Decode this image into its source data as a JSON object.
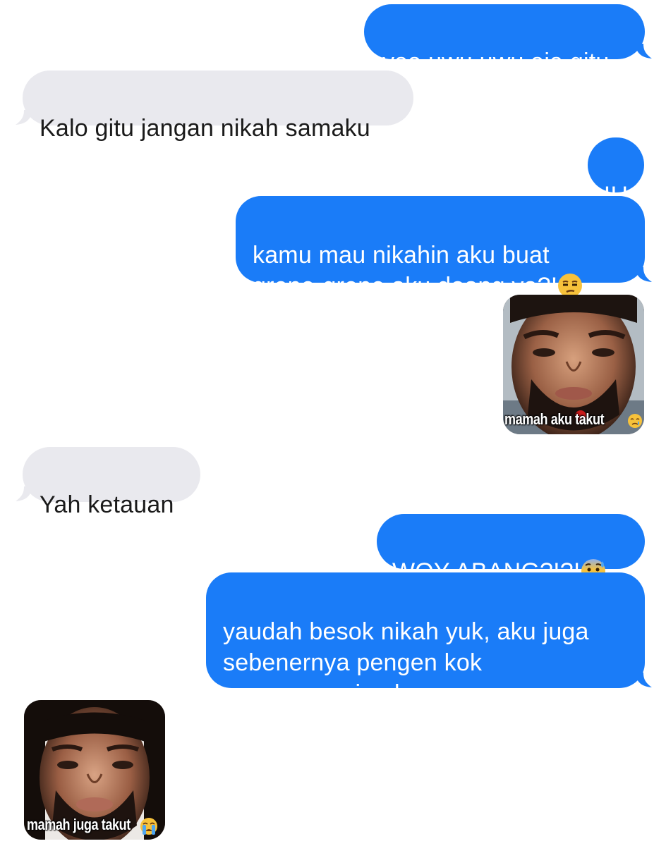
{
  "conversation": {
    "messages": [
      {
        "direction": "outgoing",
        "text": "yaa uwu uwu aja gitu"
      },
      {
        "direction": "incoming",
        "text": "Kalo gitu jangan nikah samaku"
      },
      {
        "direction": "outgoing",
        "text": "IH"
      },
      {
        "direction": "outgoing",
        "text": "kamu mau nikahin aku buat\ngrepe-grepe aku doang ya?!",
        "emoji": "unamused-face-icon"
      },
      {
        "direction": "outgoing",
        "type": "image",
        "caption": "mamah aku takut",
        "emoji": "crying-face-icon"
      },
      {
        "direction": "incoming",
        "text": "Yah ketauan"
      },
      {
        "direction": "outgoing",
        "text": "WOY ABANG?!?!",
        "emoji": "anxious-face-with-sweat-icon"
      },
      {
        "direction": "outgoing",
        "text": "yaudah besok nikah yuk, aku juga\nsebenernya pengen kok\ngrepe-grepein abang"
      },
      {
        "direction": "incoming",
        "type": "image",
        "caption": "mamah juga takut",
        "emoji": "loudly-crying-face-icon"
      }
    ]
  },
  "colors": {
    "outgoing_bubble": "#1a7cf8",
    "incoming_bubble": "#e9e9ee",
    "outgoing_text": "#ffffff",
    "incoming_text": "#1b1b1b"
  }
}
